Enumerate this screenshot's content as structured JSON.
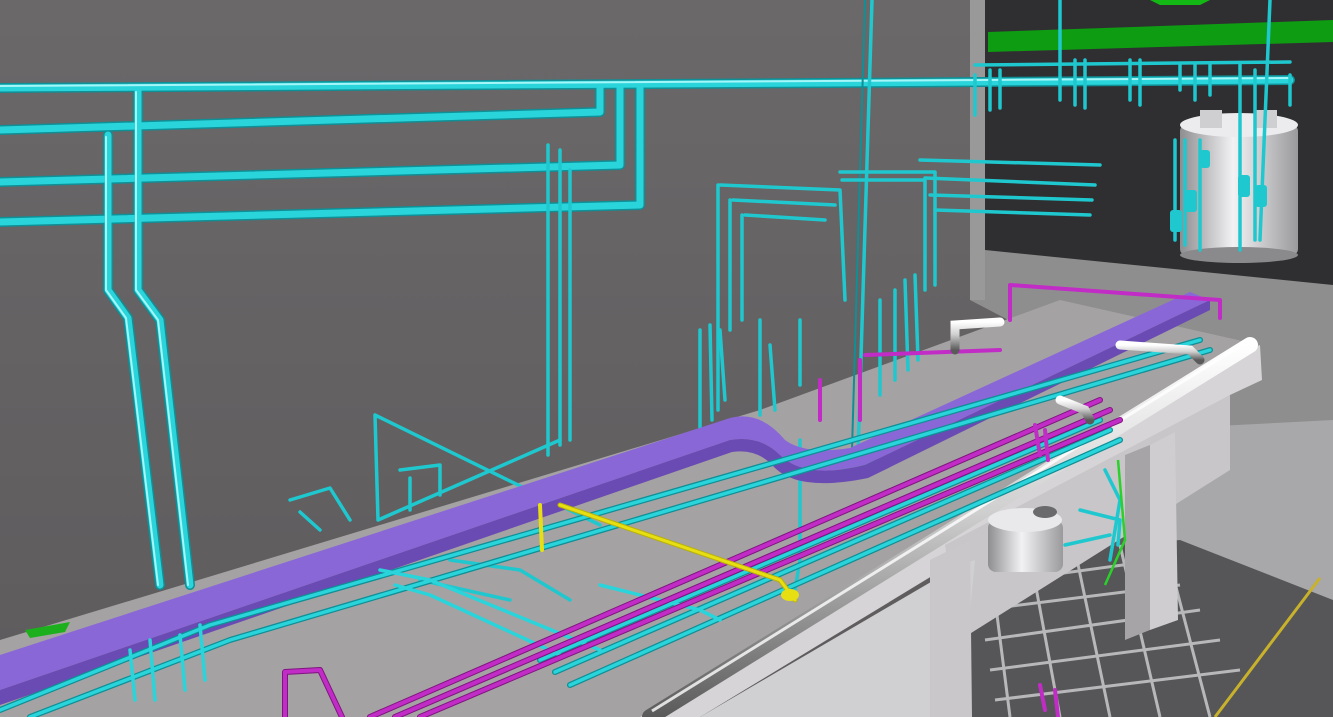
{
  "scene": {
    "colors": {
      "back_wall": "#6b696a",
      "side_wall": "#9a999a",
      "wall_shade": "#5f5d5e",
      "dark_room": "#2f2f31",
      "floor": "#a6a4a6",
      "deck_top": "#a3a1a2",
      "deck_face": "#d4d2d4",
      "deck_face_shade": "#8d8b8d",
      "support_column": "#c9c7c9",
      "grating": "#9a9a9c",
      "cyan_pipe": "#1fc8cf",
      "cyan_pipe_dark": "#0f8f96",
      "magenta_pipe": "#c22cc6",
      "magenta_pipe_dark": "#7f157f",
      "purple_duct": "#8a67d6",
      "purple_duct_dark": "#6a4ab3",
      "yellow_pipe": "#e8df12",
      "silver_pipe": "#d8d8d8",
      "green_marker": "#1dc01d",
      "green_beam": "#0e9c12",
      "vessel": "#d9d9db",
      "yellow_floor_line": "#c8b22c"
    }
  }
}
